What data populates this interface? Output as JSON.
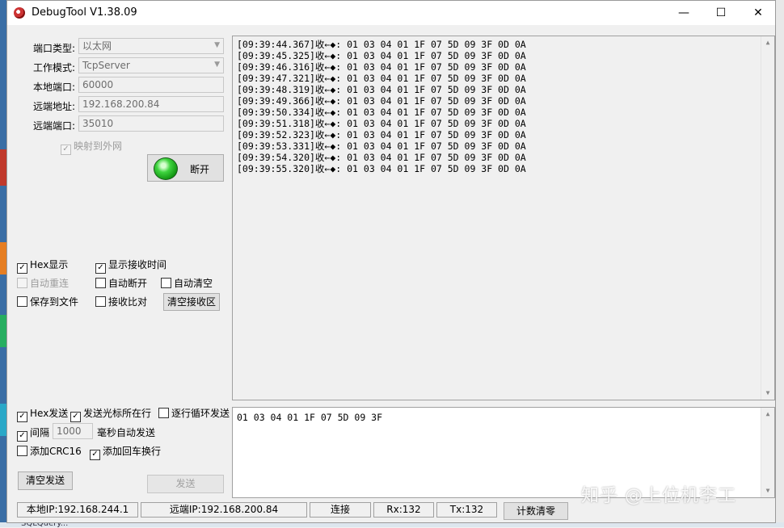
{
  "window": {
    "title": "DebugTool V1.38.09",
    "min_glyph": "—",
    "max_glyph": "☐",
    "close_glyph": "✕"
  },
  "settings": {
    "port_type_label": "端口类型:",
    "port_type_value": "以太网",
    "work_mode_label": "工作模式:",
    "work_mode_value": "TcpServer",
    "local_port_label": "本地端口:",
    "local_port_value": "60000",
    "remote_addr_label": "远端地址:",
    "remote_addr_value": "192.168.200.84",
    "remote_port_label": "远端端口:",
    "remote_port_value": "35010",
    "map_external_label": "映射到外网",
    "disconnect_label": "断开"
  },
  "recv_options": {
    "hex_display": "Hex显示",
    "show_recv_time": "显示接收时间",
    "auto_reconnect": "自动重连",
    "auto_disconnect": "自动断开",
    "auto_clear": "自动清空",
    "save_to_file": "保存到文件",
    "recv_compare": "接收比对",
    "clear_recv_button": "清空接收区"
  },
  "recv_log": [
    "[09:39:44.367]收←◆: 01 03 04 01 1F 07 5D 09 3F 0D 0A",
    "[09:39:45.325]收←◆: 01 03 04 01 1F 07 5D 09 3F 0D 0A",
    "[09:39:46.316]收←◆: 01 03 04 01 1F 07 5D 09 3F 0D 0A",
    "[09:39:47.321]收←◆: 01 03 04 01 1F 07 5D 09 3F 0D 0A",
    "[09:39:48.319]收←◆: 01 03 04 01 1F 07 5D 09 3F 0D 0A",
    "[09:39:49.366]收←◆: 01 03 04 01 1F 07 5D 09 3F 0D 0A",
    "[09:39:50.334]收←◆: 01 03 04 01 1F 07 5D 09 3F 0D 0A",
    "[09:39:51.318]收←◆: 01 03 04 01 1F 07 5D 09 3F 0D 0A",
    "[09:39:52.323]收←◆: 01 03 04 01 1F 07 5D 09 3F 0D 0A",
    "[09:39:53.331]收←◆: 01 03 04 01 1F 07 5D 09 3F 0D 0A",
    "[09:39:54.320]收←◆: 01 03 04 01 1F 07 5D 09 3F 0D 0A",
    "[09:39:55.320]收←◆: 01 03 04 01 1F 07 5D 09 3F 0D 0A"
  ],
  "send_options": {
    "hex_send": "Hex发送",
    "send_cursor_line": "发送光标所在行",
    "loop_lines": "逐行循环发送",
    "interval": "间隔",
    "interval_value": "1000",
    "ms_auto_send": "毫秒自动发送",
    "add_crc16": "添加CRC16",
    "add_crlf": "添加回车换行",
    "clear_send_button": "清空发送",
    "send_button": "发送"
  },
  "send_text": "01 03 04 01 1F 07 5D 09 3F",
  "status_bar": {
    "local_ip": "本地IP:192.168.244.1",
    "remote_ip": "远端IP:192.168.200.84",
    "connect": "连接",
    "rx": "Rx:132",
    "tx": "Tx:132",
    "reset_count": "计数清零"
  },
  "watermark": "知乎 @上位机李工",
  "taskbar_fragment": "SQLQuery...",
  "check_glyph": "✓",
  "icons": {
    "scroll_up": "▲",
    "scroll_down": "▼",
    "combo_arrow": "▼"
  }
}
